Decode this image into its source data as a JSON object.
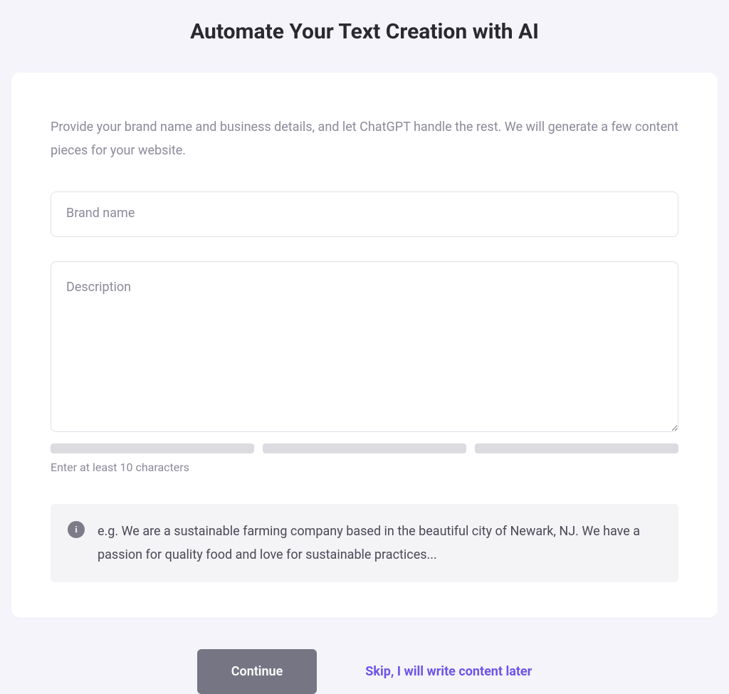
{
  "page": {
    "title": "Automate Your Text Creation with AI"
  },
  "form": {
    "intro": "Provide your brand name and business details, and let ChatGPT handle the rest. We will generate a few content pieces for your website.",
    "brand": {
      "label": "Brand name",
      "value": ""
    },
    "description": {
      "label": "Description",
      "value": ""
    },
    "helper": "Enter at least 10 characters",
    "hint": "e.g. We are a sustainable farming company based in the beautiful city of Newark, NJ. We have a passion for quality food and love for sustainable practices..."
  },
  "actions": {
    "continue": "Continue",
    "skip": "Skip, I will write content later"
  }
}
